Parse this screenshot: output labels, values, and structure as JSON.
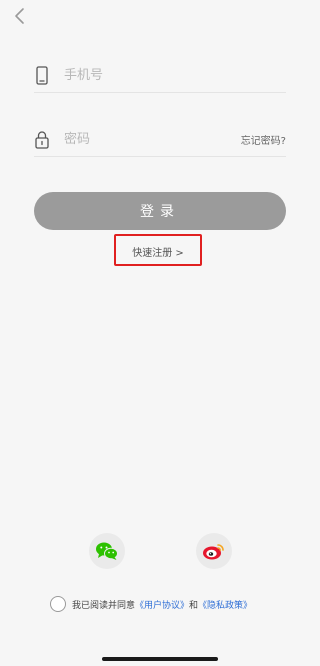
{
  "nav": {
    "back_icon": "chevron-left-icon"
  },
  "phone": {
    "icon": "phone-icon",
    "placeholder": "手机号"
  },
  "password": {
    "icon": "lock-icon",
    "placeholder": "密码",
    "forgot_label": "忘记密码?"
  },
  "login": {
    "label": "登录"
  },
  "register": {
    "label": "快速注册 >",
    "highlight_color": "#e02020"
  },
  "social": {
    "wechat_icon": "wechat-icon",
    "weibo_icon": "weibo-icon"
  },
  "agreement": {
    "prefix": "我已阅读并同意",
    "user_agreement": "《用户协议》",
    "conjunction": "和",
    "privacy_policy": "《隐私政策》",
    "link_color": "#2f6fd6"
  },
  "colors": {
    "background": "#f6f6f6",
    "button": "#9b9b9b",
    "wechat": "#2dc100",
    "weibo_red": "#e6162d",
    "weibo_orange": "#f5a623"
  }
}
